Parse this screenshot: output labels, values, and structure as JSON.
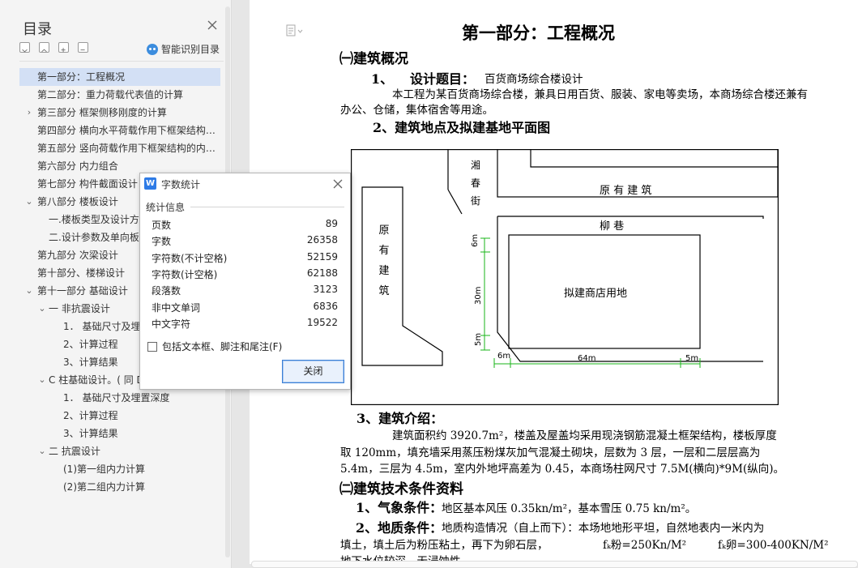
{
  "toc": {
    "title": "目录",
    "smart_label": "智能识别目录",
    "items": [
      {
        "label": "第一部分：工程概况",
        "level": 0,
        "chevron": "",
        "selected": true
      },
      {
        "label": "第二部分：重力荷载代表值的计算",
        "level": 0,
        "chevron": ""
      },
      {
        "label": "第三部分    框架侧移刚度的计算",
        "level": 0,
        "chevron": "›"
      },
      {
        "label": "第四部分  横向水平荷载作用下框架结构的...",
        "level": 0,
        "chevron": ""
      },
      {
        "label": "第五部分  竖向荷载作用下框架结构的内力...",
        "level": 0,
        "chevron": ""
      },
      {
        "label": "第六部分  内力组合",
        "level": 0,
        "chevron": ""
      },
      {
        "label": "第七部分  构件截面设计",
        "level": 0,
        "chevron": ""
      },
      {
        "label": "第八部分        楼板设计",
        "level": 0,
        "chevron": "⌄"
      },
      {
        "label": "一.楼板类型及设计方法",
        "level": 1,
        "chevron": ""
      },
      {
        "label": "二.设计参数及单向板",
        "level": 1,
        "chevron": ""
      },
      {
        "label": "第九部分        次梁设计",
        "level": 0,
        "chevron": ""
      },
      {
        "label": "第十部分、楼梯设计",
        "level": 0,
        "chevron": ""
      },
      {
        "label": "第十一部分    基础设计",
        "level": 0,
        "chevron": "⌄"
      },
      {
        "label": "一    非抗震设计",
        "level": 1,
        "chevron": "⌄"
      },
      {
        "label": "1．  基础尺寸及埋置深度",
        "level": 2,
        "chevron": ""
      },
      {
        "label": "2、计算过程",
        "level": 2,
        "chevron": ""
      },
      {
        "label": "3、计算结果",
        "level": 2,
        "chevron": ""
      },
      {
        "label": "C 柱基础设计。( 同 D 柱 )",
        "level": 1,
        "chevron": "⌄"
      },
      {
        "label": "1．  基础尺寸及埋置深度",
        "level": 2,
        "chevron": ""
      },
      {
        "label": "2、计算过程",
        "level": 2,
        "chevron": ""
      },
      {
        "label": "3、计算结果",
        "level": 2,
        "chevron": ""
      },
      {
        "label": "二    抗震设计",
        "level": 1,
        "chevron": "⌄"
      },
      {
        "label": "(1)第一组内力计算",
        "level": 2,
        "chevron": ""
      },
      {
        "label": "(2)第二组内力计算",
        "level": 2,
        "chevron": ""
      }
    ]
  },
  "document": {
    "title": "第一部分：工程概况",
    "sec1": "㈠建筑概况",
    "item1_num": "1、",
    "item1_head": "设计题目：",
    "item1_text": "百货商场综合楼设计",
    "para1_line1": "本工程为某百货商场综合楼，兼具日用百货、服装、家电等卖场，本商场综合楼还兼有",
    "para1_line2": "办公、仓储，集体宿舍等用途。",
    "item2_head": "2、建筑地点及拟建基地平面图",
    "item3_head": "3、建筑介绍：",
    "para3_line1": "建筑面积约 3920.7m²，楼盖及屋盖均采用现浇钢筋混凝土框架结构，楼板厚度",
    "para3_line2": "取 120mm，填充墙采用蒸压粉煤灰加气混凝土砌块，层数为 3 层，一层和二层层高为",
    "para3_line3": "5.4m，三层为 4.5m，室内外地坪高差为 0.45，本商场柱网尺寸 7.5M(横向)*9M(纵向)。",
    "sec2": "㈡建筑技术条件资料",
    "item4_head": "1、气象条件：",
    "item4_text": "地区基本风压 0.35kn/m²，基本雪压 0.75 kn/m²。",
    "item5_head": "2、地质条件：",
    "item5_text": "地质构造情况（自上而下）：本场地地形平坦，自然地表内一米内为",
    "para5_line2a": "填土，填土后为粉压粘土，再下为卵石层，",
    "fk1": "fₖ粉=250Kn/M²",
    "fk2": "fₖ卵=300-400KN/M²",
    "para5_line3": "地下水位较深，无浸蚀性。"
  },
  "plan": {
    "street_left": "湘\n春\n街",
    "existing_top": "原 有 建 筑",
    "existing_left": "原\n有\n建\n筑",
    "lane": "柳    巷",
    "site": "拟建商店用地",
    "dim_top": "6m",
    "dim_mid": "30m",
    "dim_bottom": "5m",
    "dim_left": "6m",
    "dim_width": "64m",
    "dim_right": "5m"
  },
  "dialog": {
    "title": "字数统计",
    "group": "统计信息",
    "stats": [
      {
        "label": "页数",
        "value": "89"
      },
      {
        "label": "字数",
        "value": "26358"
      },
      {
        "label": "字符数(不计空格)",
        "value": "52159"
      },
      {
        "label": "字符数(计空格)",
        "value": "62188"
      },
      {
        "label": "段落数",
        "value": "3123"
      },
      {
        "label": "非中文单词",
        "value": "6836"
      },
      {
        "label": "中文字符",
        "value": "19522"
      }
    ],
    "checkbox_label": "包括文本框、脚注和尾注(F)",
    "close_label": "关闭"
  }
}
